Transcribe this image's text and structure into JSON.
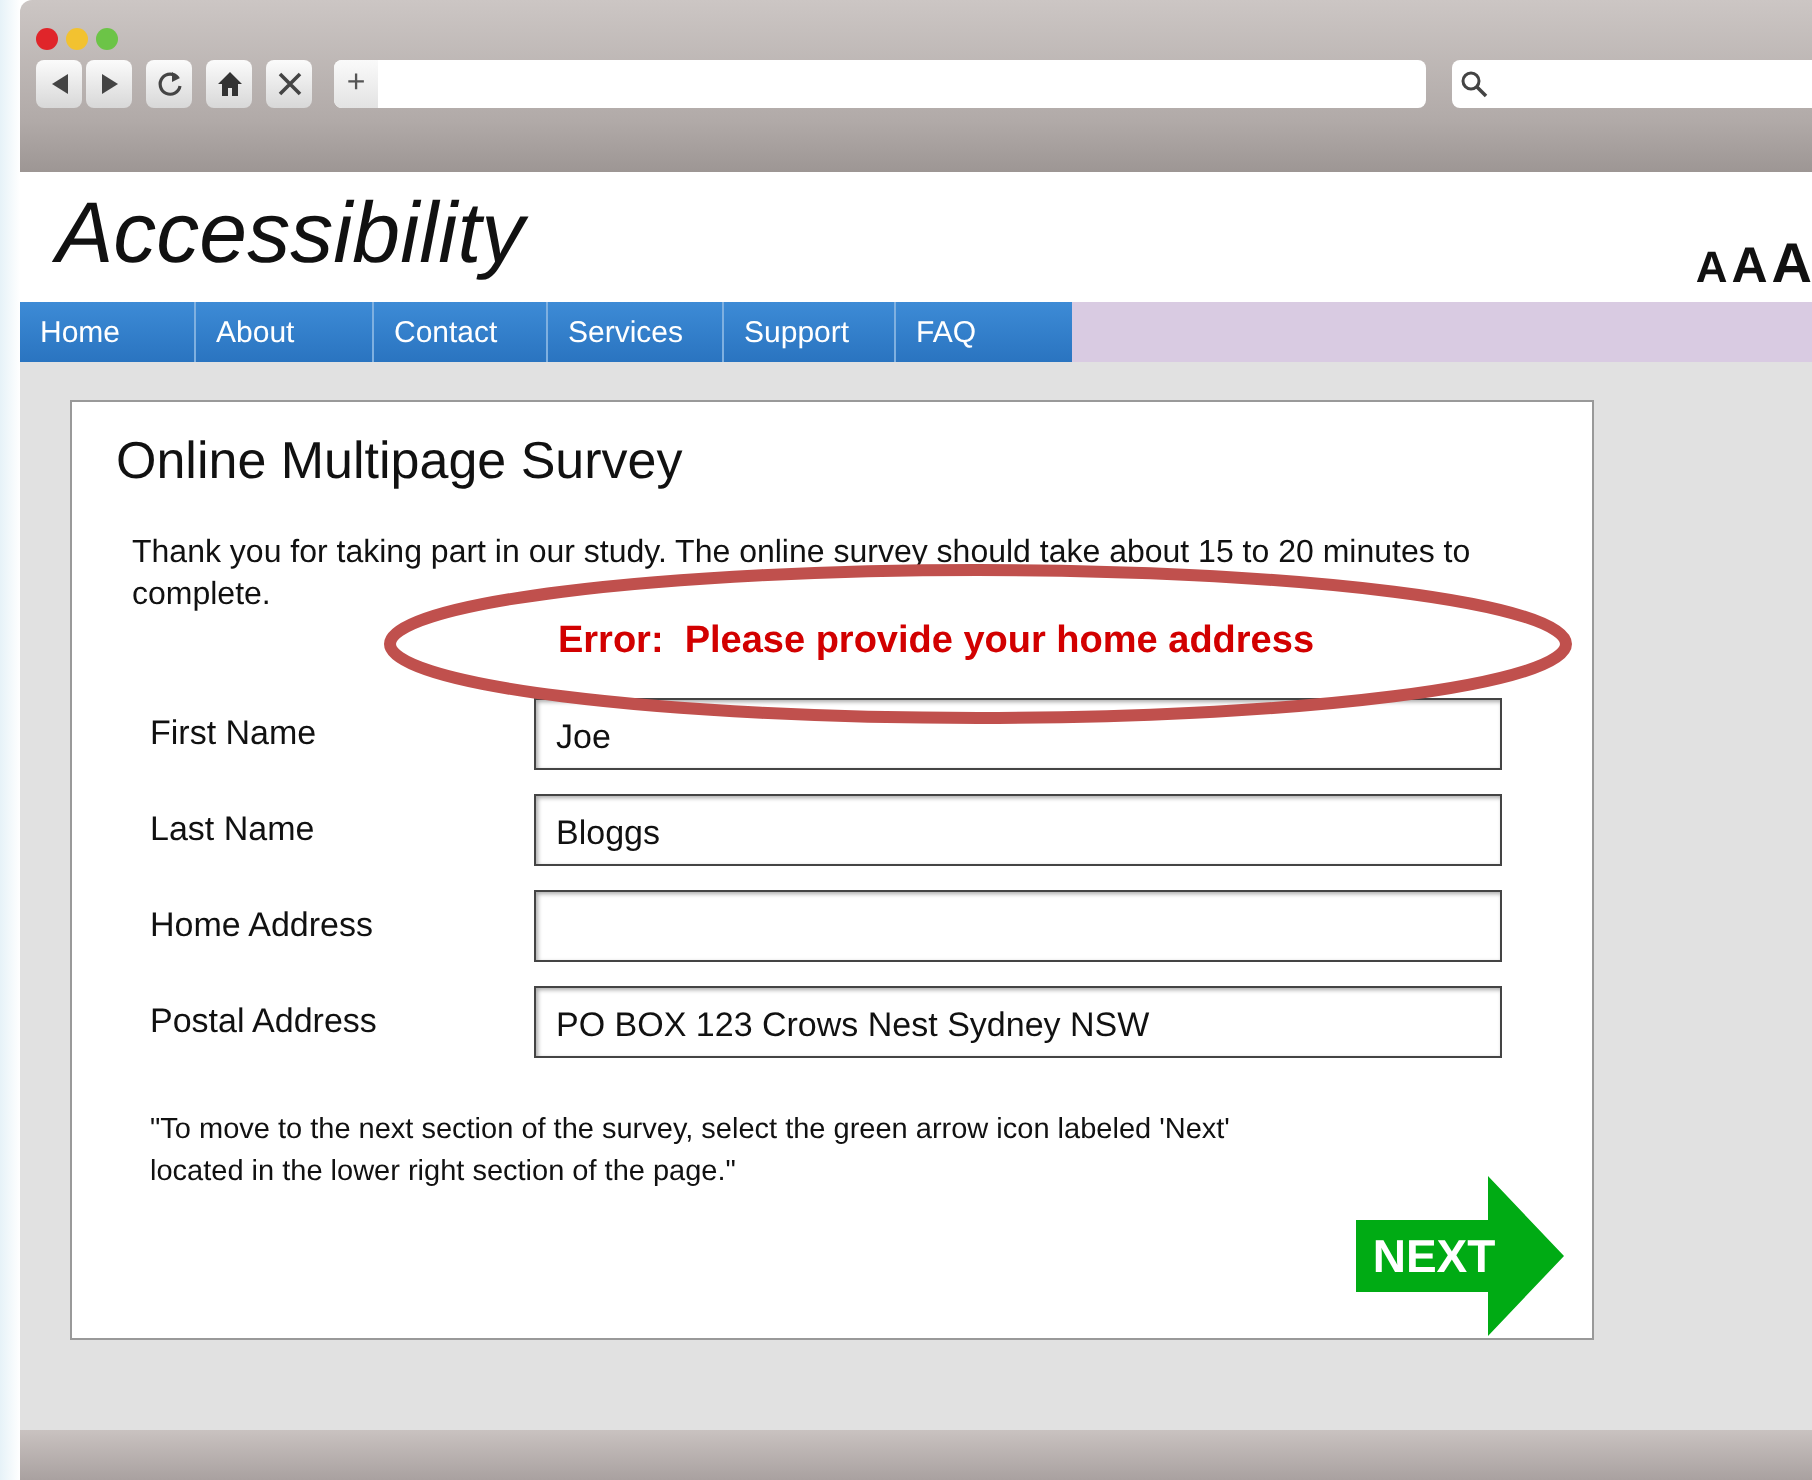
{
  "browser": {
    "new_tab": "+"
  },
  "site": {
    "title": "Accessibility",
    "text_sizes": [
      "A",
      "A",
      "A"
    ]
  },
  "nav": [
    "Home",
    "About",
    "Contact",
    "Services",
    "Support",
    "FAQ"
  ],
  "survey": {
    "title": "Online Multipage Survey",
    "intro": "Thank you for taking part in our study. The online survey should take about 15 to 20 minutes to complete.",
    "error": "Error:  Please provide your home address",
    "fields": [
      {
        "label": "First Name",
        "value": "Joe"
      },
      {
        "label": "Last Name",
        "value": "Bloggs"
      },
      {
        "label": "Home Address"
      },
      {
        "label": "Postal Address",
        "value": "PO BOX 123 Crows Nest Sydney NSW"
      }
    ],
    "note": "\"To move to the next section of the survey, select the green arrow icon labeled 'Next' located in the lower right section of the page.\"",
    "next": "NEXT"
  }
}
